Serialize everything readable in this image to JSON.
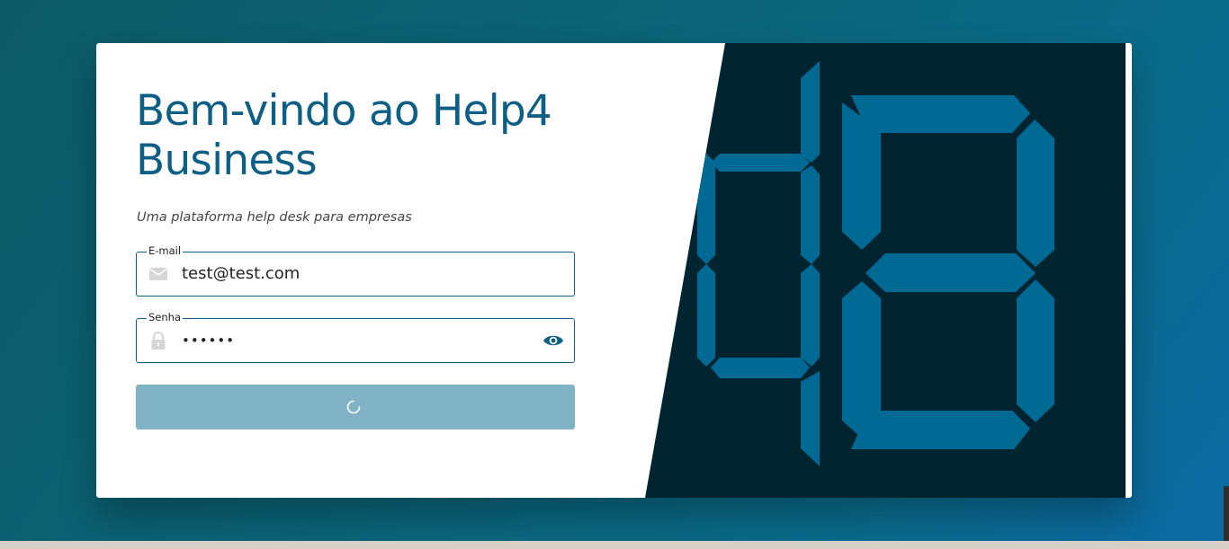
{
  "login": {
    "title": "Bem-vindo ao Help4 Business",
    "subtitle": "Uma plataforma help desk para empresas",
    "email": {
      "label": "E-mail",
      "value": "test@test.com",
      "icon": "mail-icon"
    },
    "password": {
      "label": "Senha",
      "value": "••••••",
      "icon": "lock-icon",
      "toggle_icon": "eye-icon"
    },
    "submit": {
      "state": "loading",
      "icon": "spinner-icon"
    }
  },
  "brand": {
    "graphic": "seven-segment-4B-logo"
  },
  "colors": {
    "primary": "#0e5f86",
    "panel_dark": "#012431",
    "segment": "#006a95",
    "button_disabled": "#80b3c6",
    "background": "#0b6478"
  }
}
